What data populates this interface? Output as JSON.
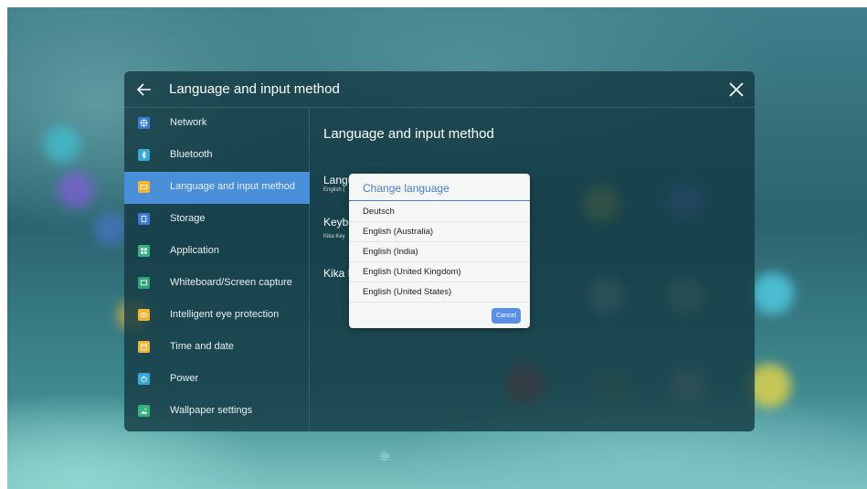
{
  "window": {
    "title": "Language and input method"
  },
  "sidebar": {
    "items": [
      {
        "label": "Network",
        "icon": "network-icon",
        "color": "#3a7bd5"
      },
      {
        "label": "Bluetooth",
        "icon": "bluetooth-icon",
        "color": "#39a7d8"
      },
      {
        "label": "Language and input method",
        "icon": "keyboard-icon",
        "color": "#f2b632",
        "active": true
      },
      {
        "label": "Storage",
        "icon": "storage-icon",
        "color": "#3a7bd5"
      },
      {
        "label": "Application",
        "icon": "application-icon",
        "color": "#36b37e"
      },
      {
        "label": "Whiteboard/Screen capture",
        "icon": "screen-capture-icon",
        "color": "#2fa37a"
      },
      {
        "label": "Intelligent eye protection",
        "icon": "eye-icon",
        "color": "#f2b632"
      },
      {
        "label": "Time and date",
        "icon": "calendar-icon",
        "color": "#f2b632"
      },
      {
        "label": "Power",
        "icon": "power-icon",
        "color": "#39a7d8"
      },
      {
        "label": "Wallpaper settings",
        "icon": "wallpaper-icon",
        "color": "#36b37e"
      }
    ]
  },
  "content": {
    "title": "Language and input method",
    "rows": [
      {
        "title": "Languages",
        "subtitle": "English ("
      },
      {
        "title": "Keybo",
        "subtitle": "Kika Key"
      },
      {
        "title": "Kika I",
        "subtitle": ""
      }
    ]
  },
  "dialog": {
    "title": "Change language",
    "options": [
      "Deutsch",
      "English (Australia)",
      "English (India)",
      "English (United Kingdom)",
      "English (United States)"
    ],
    "cancel_label": "Cancel"
  },
  "colors": {
    "accent": "#4a8fd9",
    "dialog_accent": "#4a7fd6",
    "cancel_button": "#5a8fe8"
  }
}
